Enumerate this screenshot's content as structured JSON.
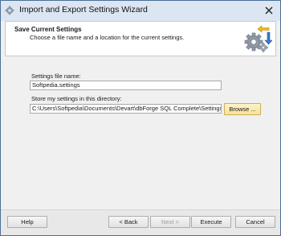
{
  "window": {
    "title": "Import and Export Settings Wizard"
  },
  "header": {
    "title": "Save Current Settings",
    "subtitle": "Choose a file name and a location for the current settings.",
    "icon": "gears-with-arrows-icon"
  },
  "form": {
    "file_name_label": "Settings file name:",
    "file_name_value": "Softpedia.settings",
    "directory_label": "Store my settings in this directory:",
    "directory_value": "C:\\Users\\Softpedia\\Documents\\Devart\\dbForge SQL Complete\\Settings",
    "browse_label": "Browse ..."
  },
  "footer": {
    "help_label": "Help",
    "back_label": "< Back",
    "next_label": "Next >",
    "execute_label": "Execute",
    "cancel_label": "Cancel"
  },
  "colors": {
    "title_bar": "#dbe6f2",
    "window_border": "#4b6f95",
    "focused_button": "#f7e29a"
  }
}
